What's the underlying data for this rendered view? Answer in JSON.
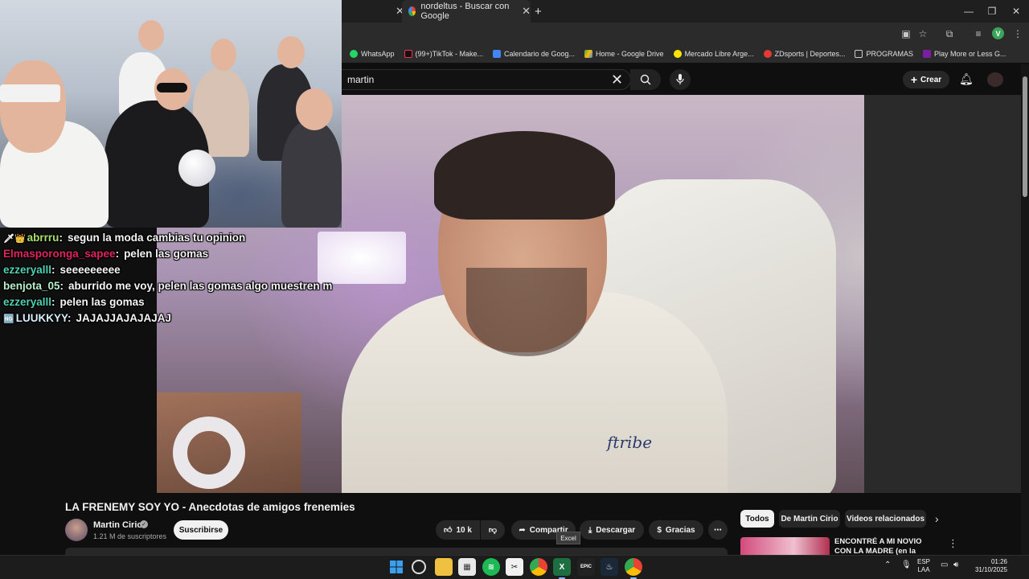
{
  "browser": {
    "tab_title": "nordeltus - Buscar con Google",
    "tab_close": "✕",
    "new_tab": "+",
    "win_min": "—",
    "win_max": "❐",
    "win_close": "✕"
  },
  "bookmarks": [
    {
      "label": "WhatsApp",
      "color": "#25d366"
    },
    {
      "label": "(99+)TikTok - Make...",
      "color": "#111111"
    },
    {
      "label": "Calendario de Goog...",
      "color": "#4285f4"
    },
    {
      "label": "Home - Google Drive",
      "color": "#fbbc05"
    },
    {
      "label": "Mercado Libre Arge...",
      "color": "#ffe600"
    },
    {
      "label": "ZDsports | Deportes...",
      "color": "#e53935"
    },
    {
      "label": "PROGRAMAS",
      "color": "#444444"
    },
    {
      "label": "Play More or Less G...",
      "color": "#7b1fa2"
    }
  ],
  "youtube": {
    "search_value": "martin",
    "create_label": "Crear",
    "video_title": "LA FRENEMY SOY YO - Anecdotas de amigos frenemies",
    "channel_name": "Martin Cirio",
    "subscribers": "1.21 M de suscriptores",
    "subscribe_label": "Suscribirse",
    "likes": "10 k",
    "share_label": "Compartir",
    "download_label": "Descargar",
    "thanks_label": "Gracias",
    "tooltip": "Excel",
    "shirt_logo": "ftribe",
    "chips": [
      "Todos",
      "De Martin Cirio",
      "Videos relacionados"
    ],
    "rec_title": "ENCONTRÉ A MI NOVIO CON LA MADRE (en la cama) -"
  },
  "chat": [
    {
      "badge": "🗡👑",
      "user": "abrrru",
      "color": "#a8e06a",
      "text": "segun la moda cambias tu opinion"
    },
    {
      "badge": "",
      "user": "Elmasporonga_sapee",
      "color": "#e0245e",
      "text": "pelen las gomas"
    },
    {
      "badge": "",
      "user": "ezzeryalll",
      "color": "#4ed1b4",
      "text": "seeeeeeeee"
    },
    {
      "badge": "",
      "user": "benjota_05",
      "color": "#b7f0c8",
      "text": "aburrido me voy, pelen las gomas algo muestren m"
    },
    {
      "badge": "",
      "user": "ezzeryalll",
      "color": "#4ed1b4",
      "text": "pelen las gomas"
    },
    {
      "badge": "🆖",
      "user": "LUUKKYY",
      "color": "#d8eefc",
      "text": "JAJAJJAJAJAJAJ"
    }
  ],
  "taskbar": {
    "lang_top": "ESP",
    "lang_bottom": "LAA",
    "time": "01:26",
    "date": "31/10/2025",
    "excel_letter": "X",
    "epic_letter": "EPIC"
  },
  "colors": {
    "yt_bg": "#0f0f0f",
    "chrome_bg": "#2b2b2b",
    "accent_blue": "#8ab4f8"
  }
}
